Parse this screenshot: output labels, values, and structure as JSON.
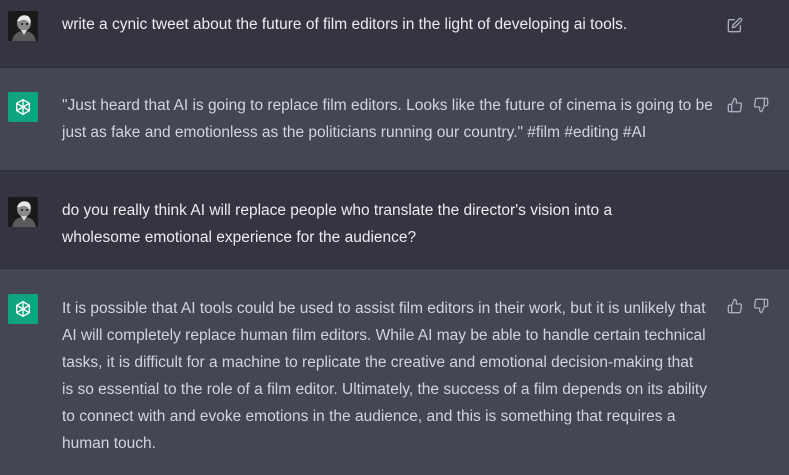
{
  "conversation": {
    "messages": [
      {
        "role": "user",
        "text": "write a cynic tweet about the future of film editors in the light of developing ai tools."
      },
      {
        "role": "assistant",
        "text": "\"Just heard that AI is going to replace film editors. Looks like the future of cinema is going to be just as fake and emotionless as the politicians running our country.\" #film #editing #AI"
      },
      {
        "role": "user",
        "text": "do you really think AI will replace people who translate the director's vision into a wholesome emotional experience for the audience?"
      },
      {
        "role": "assistant",
        "text": "It is possible that AI tools could be used to assist film editors in their work, but it is unlikely that AI will completely replace human film editors. While AI may be able to handle certain technical tasks, it is difficult for a machine to replicate the creative and emotional decision-making that is so essential to the role of a film editor. Ultimately, the success of a film depends on its ability to connect with and evoke emotions in the audience, and this is something that requires a human touch."
      }
    ]
  },
  "icons": {
    "edit": "edit-icon",
    "thumbs_up": "thumbs-up-icon",
    "thumbs_down": "thumbs-down-icon",
    "bot": "openai-logo-icon",
    "user": "user-avatar"
  },
  "colors": {
    "user_row_bg": "#343541",
    "assistant_row_bg": "#444654",
    "bot_avatar_bg": "#10a37f",
    "text": "#ececf1",
    "icon": "#acacbe"
  }
}
